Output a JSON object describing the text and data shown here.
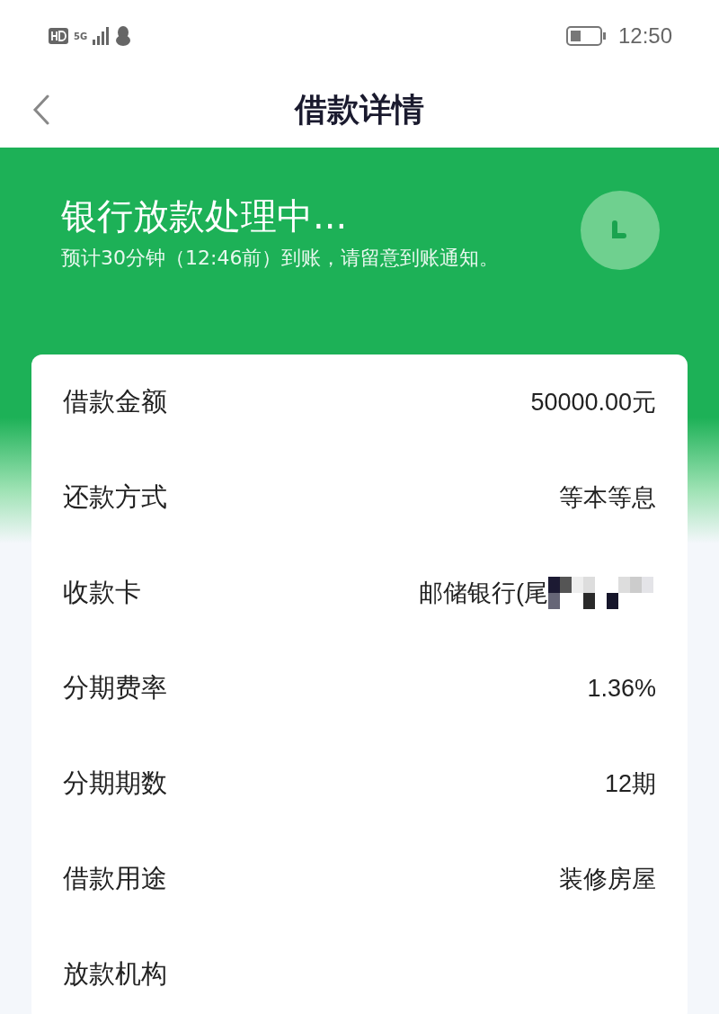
{
  "status_bar": {
    "time": "12:50",
    "network": "5G"
  },
  "header": {
    "title": "借款详情"
  },
  "banner": {
    "title": "银行放款处理中...",
    "message": "预计30分钟（12:46前）到账，请留意到账通知。"
  },
  "details": [
    {
      "label": "借款金额",
      "value": "50000.00元",
      "masked": false
    },
    {
      "label": "还款方式",
      "value": "等本等息",
      "masked": false
    },
    {
      "label": "收款卡",
      "value": "邮储银行(尾",
      "masked": true
    },
    {
      "label": "分期费率",
      "value": "1.36%",
      "masked": false
    },
    {
      "label": "分期期数",
      "value": "12期",
      "masked": false
    },
    {
      "label": "借款用途",
      "value": "装修房屋",
      "masked": false
    },
    {
      "label": "放款机构",
      "masked": false
    }
  ]
}
